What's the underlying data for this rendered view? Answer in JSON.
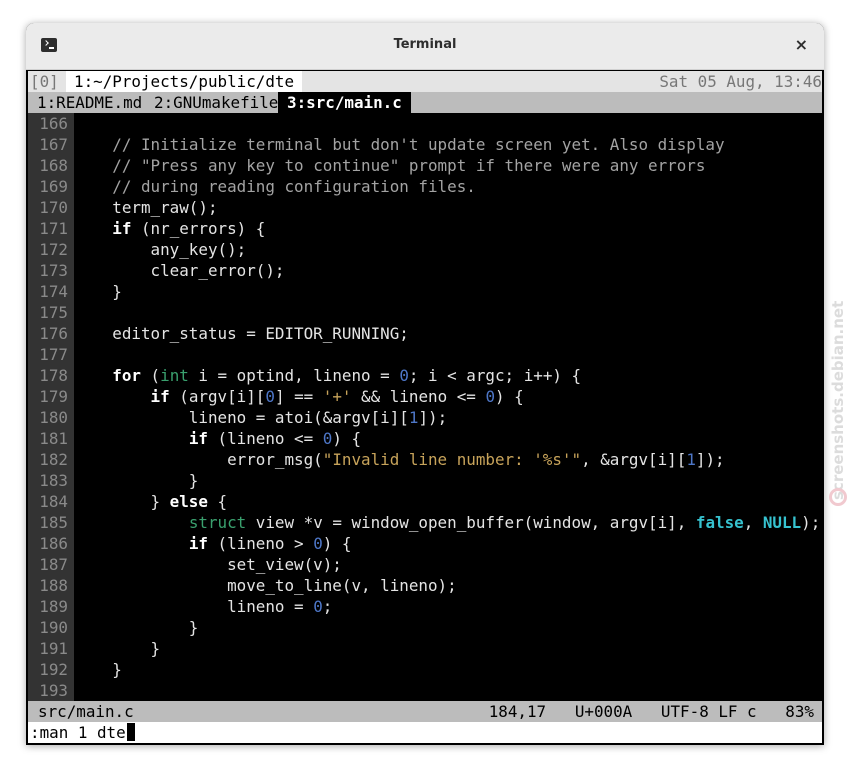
{
  "window": {
    "title": "Terminal",
    "close_icon": "×"
  },
  "tmux": {
    "window_index": "[0]",
    "window_tab": "1:~/Projects/public/dte",
    "clock": "Sat 05 Aug, 13:46"
  },
  "editor_tabs": [
    {
      "label": "1:README.md",
      "active": false
    },
    {
      "label": "2:GNUmakefile",
      "active": false
    },
    {
      "label": "3:src/main.c",
      "active": true
    }
  ],
  "code_lines": [
    {
      "num": "166",
      "text": ""
    },
    {
      "num": "167",
      "text": "    // Initialize terminal but don't update screen yet. Also display"
    },
    {
      "num": "168",
      "text": "    // \"Press any key to continue\" prompt if there were any errors"
    },
    {
      "num": "169",
      "text": "    // during reading configuration files."
    },
    {
      "num": "170",
      "text": "    term_raw();"
    },
    {
      "num": "171",
      "text": "    if (nr_errors) {"
    },
    {
      "num": "172",
      "text": "        any_key();"
    },
    {
      "num": "173",
      "text": "        clear_error();"
    },
    {
      "num": "174",
      "text": "    }"
    },
    {
      "num": "175",
      "text": ""
    },
    {
      "num": "176",
      "text": "    editor_status = EDITOR_RUNNING;"
    },
    {
      "num": "177",
      "text": ""
    },
    {
      "num": "178",
      "text": "    for (int i = optind, lineno = 0; i < argc; i++) {"
    },
    {
      "num": "179",
      "text": "        if (argv[i][0] == '+' && lineno <= 0) {"
    },
    {
      "num": "180",
      "text": "            lineno = atoi(&argv[i][1]);"
    },
    {
      "num": "181",
      "text": "            if (lineno <= 0) {"
    },
    {
      "num": "182",
      "text": "                error_msg(\"Invalid line number: '%s'\", &argv[i][1]);"
    },
    {
      "num": "183",
      "text": "            }"
    },
    {
      "num": "184",
      "text": "        } else {"
    },
    {
      "num": "185",
      "text": "            struct view *v = window_open_buffer(window, argv[i], false, NULL);"
    },
    {
      "num": "186",
      "text": "            if (lineno > 0) {"
    },
    {
      "num": "187",
      "text": "                set_view(v);"
    },
    {
      "num": "188",
      "text": "                move_to_line(v, lineno);"
    },
    {
      "num": "189",
      "text": "                lineno = 0;"
    },
    {
      "num": "190",
      "text": "            }"
    },
    {
      "num": "191",
      "text": "        }"
    },
    {
      "num": "192",
      "text": "    }"
    },
    {
      "num": "193",
      "text": ""
    }
  ],
  "status": {
    "path": "src/main.c",
    "info": "184,17   U+000A   UTF-8 LF c   83%"
  },
  "command_line": {
    "text": ":man 1 dte"
  },
  "watermark": {
    "text": "screenshots.debian.net"
  },
  "colors": {
    "keyword": "#ffffff",
    "type": "#3aa06e",
    "number": "#4e77c8",
    "string": "#c7a35a",
    "constant": "#36c2cf",
    "comment": "#a3a3a3"
  }
}
